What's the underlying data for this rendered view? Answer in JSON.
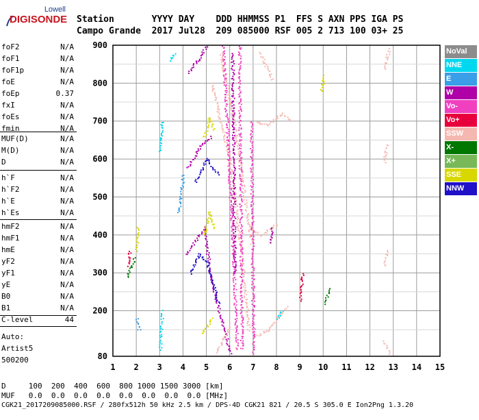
{
  "logo": {
    "top": "Lowell",
    "main": "DIGISONDE"
  },
  "header": {
    "row1": "Station       YYYY DAY    DDD HHMMSS P1  FFS S AXN PPS IGA PS",
    "row2": "Campo Grande  2017 Jul28  209 085000 RSF 005 2 713 100 03+ 25"
  },
  "params": {
    "group1": [
      {
        "label": "foF2",
        "value": "N/A"
      },
      {
        "label": "foF1",
        "value": "N/A"
      },
      {
        "label": "foF1p",
        "value": "N/A"
      },
      {
        "label": "foE",
        "value": "N/A"
      },
      {
        "label": "foEp",
        "value": "0.37"
      },
      {
        "label": "fxI",
        "value": "N/A"
      },
      {
        "label": "foEs",
        "value": "N/A"
      },
      {
        "label": "fmin",
        "value": "N/A"
      }
    ],
    "group2": [
      {
        "label": "MUF(D)",
        "value": "N/A"
      },
      {
        "label": "M(D)",
        "value": "N/A"
      },
      {
        "label": "D",
        "value": "N/A"
      }
    ],
    "group3": [
      {
        "label": "h`F",
        "value": "N/A"
      },
      {
        "label": "h`F2",
        "value": "N/A"
      },
      {
        "label": "h`E",
        "value": "N/A"
      },
      {
        "label": "h`Es",
        "value": "N/A"
      }
    ],
    "group4": [
      {
        "label": "hmF2",
        "value": "N/A"
      },
      {
        "label": "hmF1",
        "value": "N/A"
      },
      {
        "label": "hmE",
        "value": "N/A"
      },
      {
        "label": "yF2",
        "value": "N/A"
      },
      {
        "label": "yF1",
        "value": "N/A"
      },
      {
        "label": "yE",
        "value": "N/A"
      },
      {
        "label": "B0",
        "value": "N/A"
      },
      {
        "label": "B1",
        "value": "N/A"
      }
    ],
    "clevel": {
      "label": "C-level",
      "value": "44"
    },
    "auto": [
      "Auto:",
      "Artist5",
      "500200"
    ]
  },
  "legend": [
    {
      "label": "NoVal",
      "color": "#8c8c8c"
    },
    {
      "label": "NNE",
      "color": "#00d8f0"
    },
    {
      "label": "E",
      "color": "#3a9ee8"
    },
    {
      "label": "W",
      "color": "#b000a8"
    },
    {
      "label": "Vo-",
      "color": "#f040c0"
    },
    {
      "label": "Vo+",
      "color": "#e8003c"
    },
    {
      "label": "SSW",
      "color": "#f4b8b0"
    },
    {
      "label": "X-",
      "color": "#007800"
    },
    {
      "label": "X+",
      "color": "#78b858"
    },
    {
      "label": "SSE",
      "color": "#d8d800"
    },
    {
      "label": "NNW",
      "color": "#2010c8"
    }
  ],
  "footer": {
    "row1": "D     100  200  400  600  800 1000 1500 3000 [km]",
    "row2": "MUF   0.0  0.0  0.0  0.0  0.0  0.0  0.0  0.0 [MHz]",
    "row3": "CGK21_2017209085000.RSF / 280fx512h 50 kHz 2.5 km / DPS-4D CGK21 821 / 20.5 S 305.0 E Ion2Png 1.3.20"
  },
  "chart_data": {
    "type": "scatter",
    "xlim": [
      1,
      15
    ],
    "ylim": [
      80,
      900
    ],
    "xticks": [
      1,
      2,
      3,
      4,
      5,
      6,
      7,
      8,
      9,
      10,
      11,
      12,
      13,
      14,
      15
    ],
    "yticks": [
      80,
      200,
      300,
      400,
      500,
      600,
      700,
      800,
      900
    ],
    "grid": true,
    "traces": [
      {
        "cls": "W",
        "x": [
          4.1,
          4.9,
          5.2,
          6.0
        ],
        "y": [
          350,
          420,
          280,
          90
        ]
      },
      {
        "cls": "W",
        "x": [
          4.2,
          4.8,
          5.2
        ],
        "y": [
          580,
          640,
          660
        ]
      },
      {
        "cls": "W",
        "x": [
          4.2,
          4.6,
          5.0
        ],
        "y": [
          830,
          860,
          900
        ]
      },
      {
        "cls": "NNW",
        "x": [
          4.3,
          4.7,
          5.0,
          5.5
        ],
        "y": [
          300,
          350,
          330,
          220
        ]
      },
      {
        "cls": "NNW",
        "x": [
          4.5,
          5.0,
          5.5
        ],
        "y": [
          540,
          600,
          560
        ]
      },
      {
        "cls": "SSE",
        "x": [
          4.9,
          5.1,
          5.3
        ],
        "y": [
          400,
          460,
          420
        ]
      },
      {
        "cls": "SSE",
        "x": [
          4.9,
          5.1,
          5.3
        ],
        "y": [
          660,
          710,
          680
        ]
      },
      {
        "cls": "SSE",
        "x": [
          4.8,
          5.2
        ],
        "y": [
          140,
          180
        ]
      },
      {
        "cls": "SSW",
        "x": [
          5.2,
          6.0,
          6.4,
          6.8
        ],
        "y": [
          800,
          600,
          400,
          150
        ]
      },
      {
        "cls": "SSW",
        "x": [
          5.6,
          6.3,
          6.9
        ],
        "y": [
          880,
          650,
          380
        ]
      },
      {
        "cls": "SSW",
        "x": [
          7.1,
          7.6,
          8.2,
          8.6
        ],
        "y": [
          700,
          690,
          720,
          700
        ]
      },
      {
        "cls": "SSW",
        "x": [
          6.8,
          7.3,
          8.0
        ],
        "y": [
          420,
          400,
          430
        ]
      },
      {
        "cls": "SSW",
        "x": [
          7.0,
          7.6,
          8.4
        ],
        "y": [
          130,
          150,
          210
        ]
      },
      {
        "cls": "SSW",
        "x": [
          5.4,
          6.0
        ],
        "y": [
          90,
          160
        ]
      },
      {
        "cls": "SSW",
        "x": [
          7.3,
          7.8
        ],
        "y": [
          880,
          810
        ]
      },
      {
        "cls": "Vo-",
        "x": [
          5.7,
          5.9,
          6.1,
          6.3
        ],
        "y": [
          900,
          650,
          400,
          100
        ]
      },
      {
        "cls": "Vo-",
        "x": [
          6.4,
          6.5
        ],
        "y": [
          900,
          100
        ]
      },
      {
        "cls": "Vo-",
        "x": [
          6.9,
          7.0
        ],
        "y": [
          700,
          90
        ]
      },
      {
        "cls": "W",
        "x": [
          6.1,
          6.2
        ],
        "y": [
          880,
          300
        ]
      },
      {
        "cls": "NNE",
        "x": [
          3.0,
          3.1
        ],
        "y": [
          100,
          200
        ]
      },
      {
        "cls": "NNE",
        "x": [
          3.0,
          3.1
        ],
        "y": [
          620,
          700
        ]
      },
      {
        "cls": "E",
        "x": [
          2.0,
          2.1
        ],
        "y": [
          180,
          150
        ]
      },
      {
        "cls": "E",
        "x": [
          3.8,
          4.0
        ],
        "y": [
          460,
          560
        ]
      },
      {
        "cls": "X-",
        "x": [
          1.6,
          1.9
        ],
        "y": [
          290,
          340
        ]
      },
      {
        "cls": "Vo+",
        "x": [
          1.65,
          1.7
        ],
        "y": [
          320,
          360
        ]
      },
      {
        "cls": "SSE",
        "x": [
          2.0,
          2.05
        ],
        "y": [
          360,
          420
        ]
      },
      {
        "cls": "NNE",
        "x": [
          3.4,
          3.6
        ],
        "y": [
          860,
          880
        ]
      },
      {
        "cls": "SSE",
        "x": [
          9.9,
          10.0
        ],
        "y": [
          780,
          820
        ]
      },
      {
        "cls": "X-",
        "x": [
          10.1,
          10.2
        ],
        "y": [
          220,
          260
        ]
      },
      {
        "cls": "Vo+",
        "x": [
          9.0,
          9.1
        ],
        "y": [
          230,
          300
        ]
      },
      {
        "cls": "SSW",
        "x": [
          12.6,
          12.8
        ],
        "y": [
          120,
          90
        ]
      },
      {
        "cls": "SSW",
        "x": [
          12.6,
          12.7
        ],
        "y": [
          320,
          360
        ]
      },
      {
        "cls": "SSW",
        "x": [
          12.6,
          12.7
        ],
        "y": [
          590,
          640
        ]
      },
      {
        "cls": "SSW",
        "x": [
          12.6,
          12.8
        ],
        "y": [
          840,
          890
        ]
      },
      {
        "cls": "NNE",
        "x": [
          8.0,
          8.2
        ],
        "y": [
          180,
          200
        ]
      },
      {
        "cls": "W",
        "x": [
          7.7,
          7.8
        ],
        "y": [
          380,
          420
        ]
      }
    ]
  }
}
